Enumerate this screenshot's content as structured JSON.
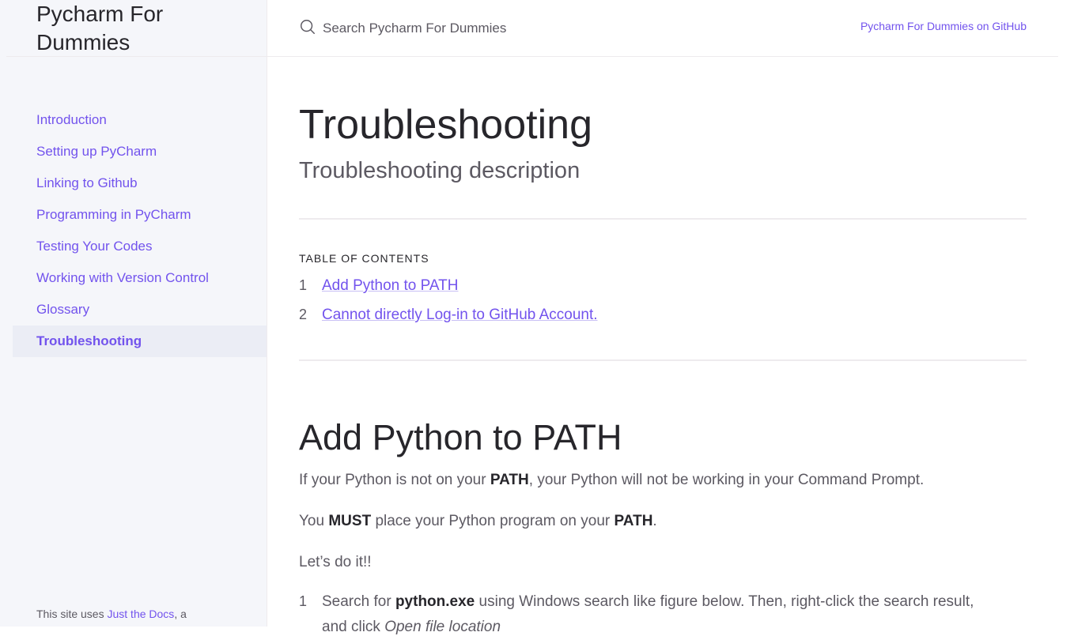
{
  "site": {
    "title": "Pycharm For Dummies"
  },
  "nav": {
    "items": [
      {
        "label": "Introduction"
      },
      {
        "label": "Setting up PyCharm"
      },
      {
        "label": "Linking to Github"
      },
      {
        "label": "Programming in PyCharm"
      },
      {
        "label": "Testing Your Codes"
      },
      {
        "label": "Working with Version Control"
      },
      {
        "label": "Glossary"
      },
      {
        "label": "Troubleshooting",
        "active": true
      }
    ]
  },
  "footer": {
    "prefix": "This site uses ",
    "link": "Just the Docs",
    "suffix": ", a"
  },
  "search": {
    "placeholder": "Search Pycharm For Dummies",
    "icon": "search-icon"
  },
  "aux_link": {
    "label": "Pycharm For Dummies on GitHub"
  },
  "page": {
    "title": "Troubleshooting",
    "subtitle": "Troubleshooting description",
    "toc": {
      "heading": "TABLE OF CONTENTS",
      "items": [
        {
          "num": "1",
          "label": "Add Python to PATH"
        },
        {
          "num": "2",
          "label": "Cannot directly Log-in to GitHub Account."
        }
      ]
    },
    "section": {
      "heading": "Add Python to PATH",
      "p1": {
        "a": "If your Python is not on your ",
        "b": "PATH",
        "c": ", your Python will not be working in your Command Prompt."
      },
      "p2": {
        "a": "You ",
        "b": "MUST",
        "c": " place your Python program on your ",
        "d": "PATH",
        "e": "."
      },
      "p3": "Let’s do it!!",
      "step1": {
        "num": "1",
        "a": "Search for ",
        "b": "python.exe",
        "c": " using Windows search like figure below. Then, right-click the search result,",
        "d": "and click ",
        "e": "Open file location"
      }
    }
  },
  "colors": {
    "accent": "#7253ed",
    "sidebar_bg": "#f5f6fa",
    "text": "#5c5962",
    "heading": "#27262b"
  }
}
